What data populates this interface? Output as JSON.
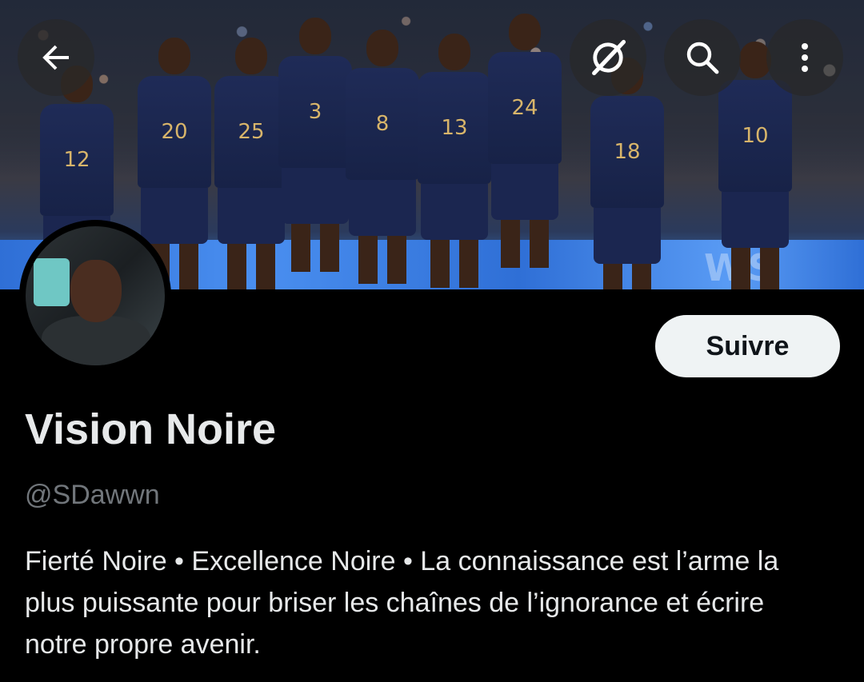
{
  "banner": {
    "description_icon": "team-photo-banner",
    "players": [
      "12",
      "20",
      "25",
      "3",
      "8",
      "13",
      "24",
      "18",
      "10"
    ],
    "board_text": "WS"
  },
  "toolbar": {
    "back_icon": "arrow-left-icon",
    "grok_icon": "slash-circle-icon",
    "search_icon": "search-icon",
    "more_icon": "more-vertical-icon"
  },
  "profile": {
    "name": "Vision Noire",
    "handle": "@SDawwn",
    "bio": "Fierté Noire • Excellence Noire • La connaissance est l’arme la plus puissante pour briser les chaînes de l’ignorance et écrire notre propre avenir.",
    "follow_label": "Suivre"
  },
  "colors": {
    "background": "#000000",
    "text_primary": "#e7e9ea",
    "text_secondary": "#71767b",
    "button_bg": "#eff3f4",
    "button_text": "#0f1419"
  }
}
